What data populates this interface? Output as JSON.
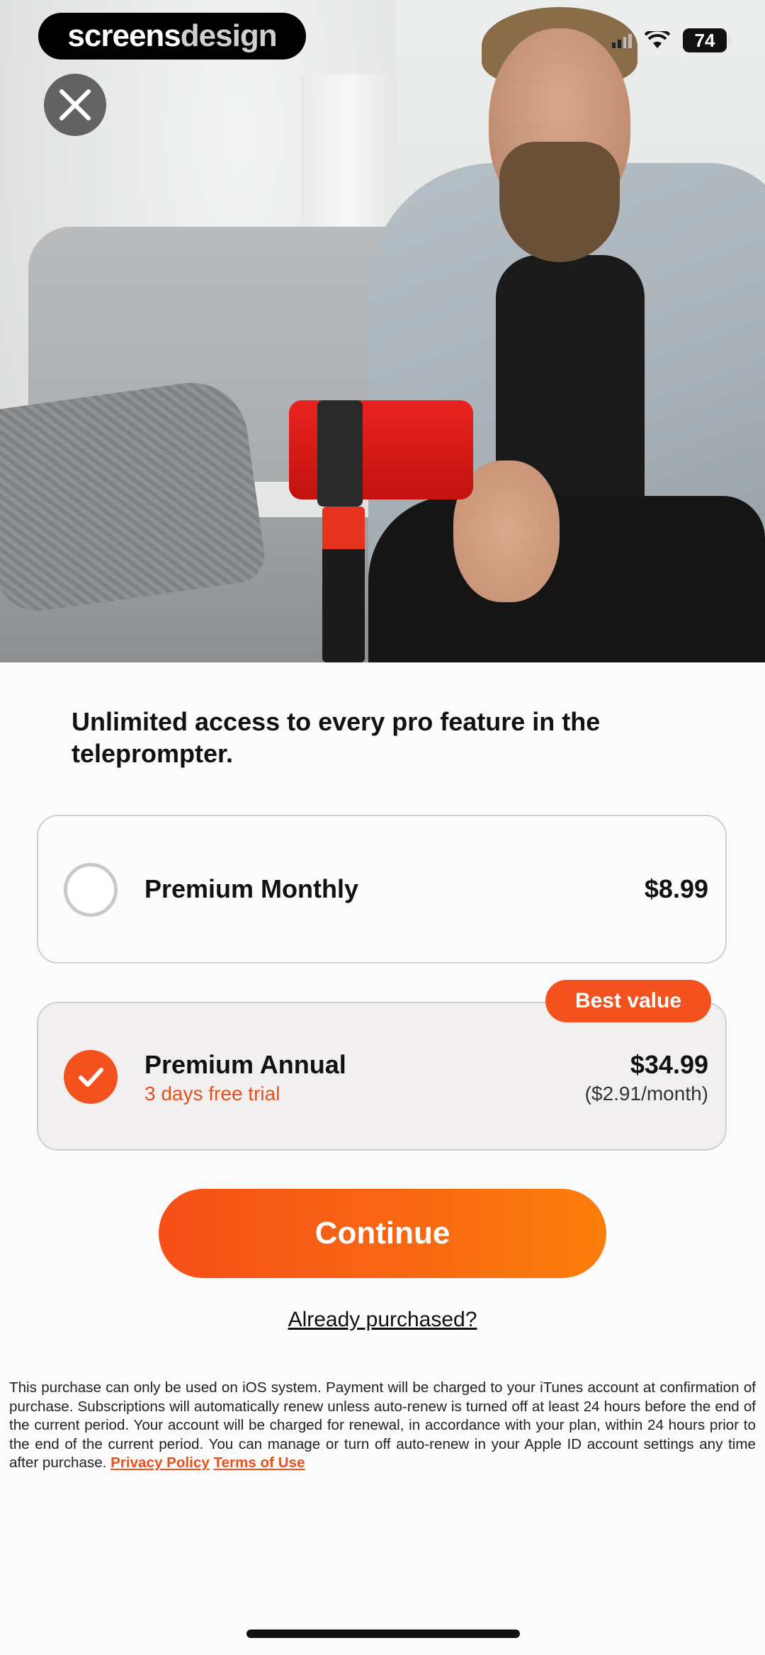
{
  "watermark": {
    "part1": "screens",
    "part2": "design"
  },
  "status_bar": {
    "battery": "74"
  },
  "headline": "Unlimited access to every pro feature in the teleprompter.",
  "plans": [
    {
      "name": "Premium Monthly",
      "price": "$8.99",
      "selected": false
    },
    {
      "name": "Premium Annual",
      "trial": "3 days free trial",
      "price": "$34.99",
      "per_month": "($2.91/month)",
      "selected": true,
      "badge": "Best value"
    }
  ],
  "cta": {
    "continue": "Continue",
    "restore": "Already purchased?"
  },
  "legal": {
    "text": "This purchase can only be used on iOS system. Payment will be charged to your iTunes account at confirmation of purchase. Subscriptions will automatically renew unless auto-renew is turned off at least 24 hours before the end of the current period. Your account will be charged for renewal, in accordance with your plan, within 24 hours prior to the end of the current period. You can manage or turn off auto-renew in your Apple ID account settings any time after purchase.",
    "privacy": "Privacy Policy",
    "terms": "Terms of Use"
  },
  "colors": {
    "accent": "#f3521e",
    "accent_gradient_end": "#fb7e0b",
    "border": "#cfcfcf"
  }
}
